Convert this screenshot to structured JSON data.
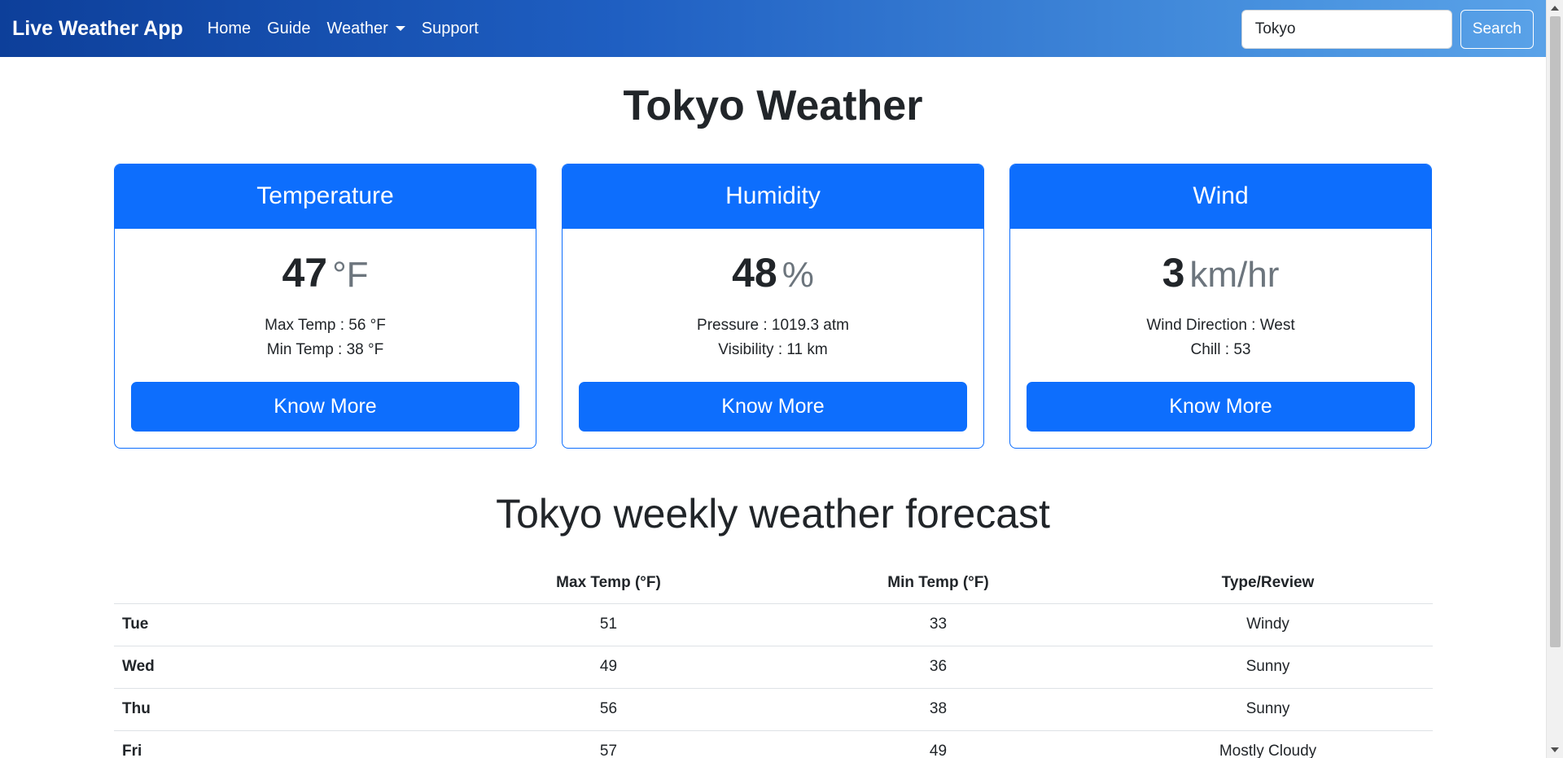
{
  "navbar": {
    "brand": "Live Weather App",
    "links": [
      "Home",
      "Guide",
      "Weather",
      "Support"
    ],
    "search_value": "Tokyo",
    "search_label": "Search"
  },
  "title": "Tokyo Weather",
  "cards": {
    "temperature": {
      "header": "Temperature",
      "value": "47",
      "unit": "°F",
      "line1": "Max Temp : 56 °F",
      "line2": "Min Temp : 38 °F",
      "button": "Know More"
    },
    "humidity": {
      "header": "Humidity",
      "value": "48",
      "unit": "%",
      "line1": "Pressure : 1019.3 atm",
      "line2": "Visibility : 11 km",
      "button": "Know More"
    },
    "wind": {
      "header": "Wind",
      "value": "3",
      "unit": "km/hr",
      "line1": "Wind Direction : West",
      "line2": "Chill : 53",
      "button": "Know More"
    }
  },
  "forecast": {
    "title": "Tokyo weekly weather forecast",
    "headers": [
      "",
      "Max Temp (°F)",
      "Min Temp (°F)",
      "Type/Review"
    ],
    "rows": [
      [
        "Tue",
        "51",
        "33",
        "Windy"
      ],
      [
        "Wed",
        "49",
        "36",
        "Sunny"
      ],
      [
        "Thu",
        "56",
        "38",
        "Sunny"
      ],
      [
        "Fri",
        "57",
        "49",
        "Mostly Cloudy"
      ]
    ]
  },
  "colors": {
    "primary": "#0d6efd",
    "navbar_start": "#0d3f9a",
    "navbar_end": "#5aa2e8"
  }
}
